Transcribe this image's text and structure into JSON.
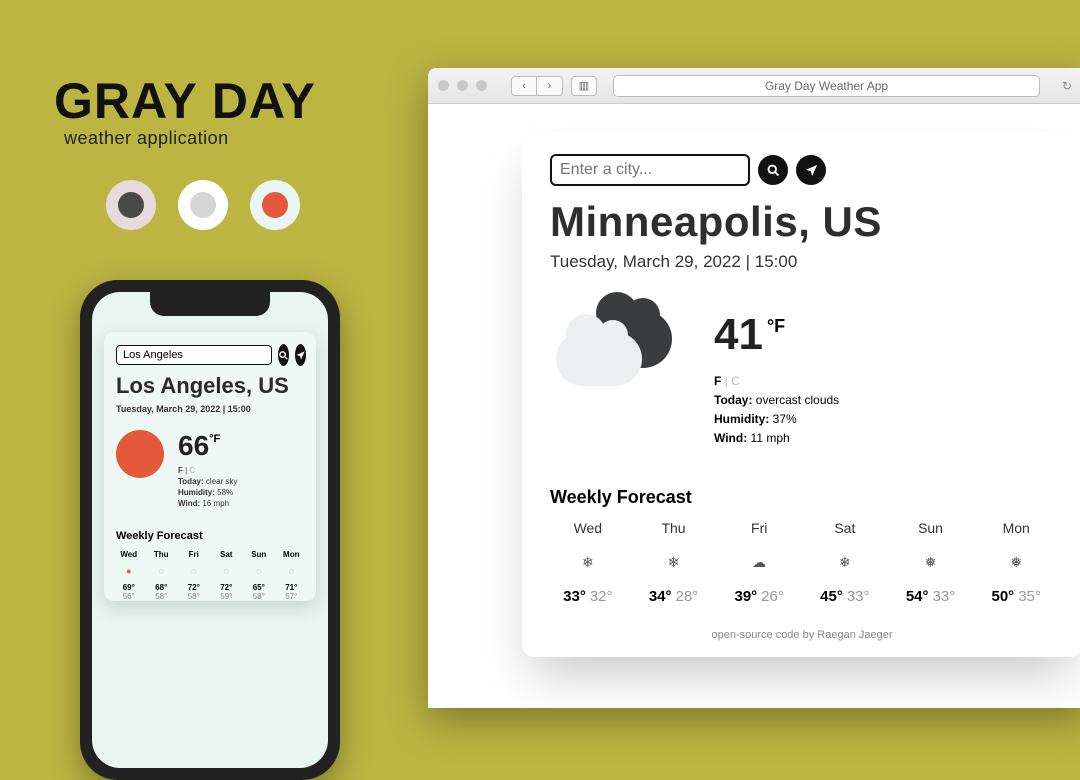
{
  "hero": {
    "title": "GRAY DAY",
    "subtitle": "weather application"
  },
  "swatches": [
    {
      "outer": "#e8d9dc",
      "inner": "#4a4a4a"
    },
    {
      "outer": "#ffffff",
      "inner": "#d6d6d6"
    },
    {
      "outer": "#eaf6f3",
      "inner": "#e3593a"
    }
  ],
  "phone": {
    "search_value": "Los Angeles",
    "city": "Los Angeles, US",
    "datetime": "Tuesday, March 29, 2022 | 15:00",
    "temp": "66",
    "temp_unit": "°F",
    "unit_toggle_active": "F",
    "unit_toggle_sep": " | ",
    "unit_toggle_inactive": "C",
    "today_label": "Today:",
    "today_value": " clear sky",
    "humidity_label": "Humidity:",
    "humidity_value": " 58%",
    "wind_label": "Wind:",
    "wind_value": " 16 mph",
    "weekly_label": "Weekly Forecast",
    "forecast": [
      {
        "day": "Wed",
        "icon": "●",
        "hi": "69°",
        "lo": "56°"
      },
      {
        "day": "Thu",
        "icon": "◌",
        "hi": "68°",
        "lo": "58°"
      },
      {
        "day": "Fri",
        "icon": "◌",
        "hi": "72°",
        "lo": "58°"
      },
      {
        "day": "Sat",
        "icon": "◌",
        "hi": "72°",
        "lo": "59°"
      },
      {
        "day": "Sun",
        "icon": "◌",
        "hi": "65°",
        "lo": "58°"
      },
      {
        "day": "Mon",
        "icon": "◌",
        "hi": "71°",
        "lo": "57°"
      }
    ]
  },
  "browser": {
    "page_title": "Gray Day Weather App",
    "search_placeholder": "Enter a city...",
    "city": "Minneapolis, US",
    "datetime": "Tuesday, March 29, 2022 | 15:00",
    "temp": "41",
    "temp_unit": "°F",
    "unit_toggle_active": "F",
    "unit_toggle_sep": " | ",
    "unit_toggle_inactive": "C",
    "today_label": "Today:",
    "today_value": " overcast clouds",
    "humidity_label": "Humidity:",
    "humidity_value": " 37%",
    "wind_label": "Wind:",
    "wind_value": " 11 mph",
    "weekly_label": "Weekly Forecast",
    "forecast": [
      {
        "day": "Wed",
        "icon": "❄",
        "hi": "33°",
        "lo": "32°"
      },
      {
        "day": "Thu",
        "icon": "❄",
        "hi": "34°",
        "lo": "28°"
      },
      {
        "day": "Fri",
        "icon": "☁",
        "hi": "39°",
        "lo": "26°"
      },
      {
        "day": "Sat",
        "icon": "❄",
        "hi": "45°",
        "lo": "33°"
      },
      {
        "day": "Sun",
        "icon": "❅",
        "hi": "54°",
        "lo": "33°"
      },
      {
        "day": "Mon",
        "icon": "❅",
        "hi": "50°",
        "lo": "35°"
      }
    ],
    "credit_link": "open-source code",
    "credit_by": " by Raegan Jaeger"
  }
}
